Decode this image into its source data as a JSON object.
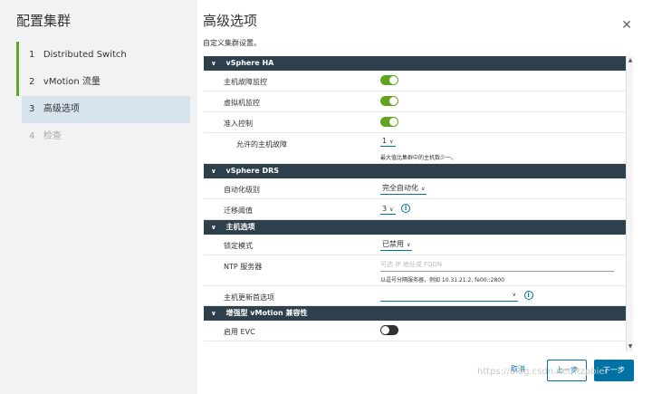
{
  "sidebar": {
    "title": "配置集群",
    "steps": [
      {
        "num": "1",
        "label": "Distributed Switch"
      },
      {
        "num": "2",
        "label": "vMotion 流量"
      },
      {
        "num": "3",
        "label": "高级选项"
      },
      {
        "num": "4",
        "label": "检查"
      }
    ]
  },
  "main": {
    "title": "高级选项",
    "subtitle": "自定义集群设置。",
    "close_icon": "close-icon"
  },
  "sections": {
    "ha": {
      "title": "vSphere HA",
      "host_monitoring": {
        "label": "主机故障监控",
        "state": "on"
      },
      "vm_monitoring": {
        "label": "虚拟机监控",
        "state": "on"
      },
      "admission_control": {
        "label": "准入控制",
        "state": "on"
      },
      "host_failures": {
        "label": "允许的主机故障",
        "value": "1",
        "hint": "最大值比集群中的主机数少一。"
      }
    },
    "drs": {
      "title": "vSphere DRS",
      "automation": {
        "label": "自动化级别",
        "value": "完全自动化"
      },
      "migration": {
        "label": "迁移阈值",
        "value": "3"
      }
    },
    "host": {
      "title": "主机选项",
      "lockdown": {
        "label": "锁定模式",
        "value": "已禁用"
      },
      "ntp": {
        "label": "NTP 服务器",
        "placeholder": "可选 IP 地址或 FQDN",
        "hint": "以逗号分隔服务器，例如 10.31.21.2, fe00::2800"
      },
      "update": {
        "label": "主机更新首选项",
        "value": ""
      }
    },
    "evc": {
      "title": "增强型 vMotion 兼容性",
      "enable": {
        "label": "启用 EVC",
        "state": "off"
      }
    }
  },
  "footer": {
    "cancel": "取消",
    "back": "上一步",
    "next": "下一步"
  },
  "watermark": "https://blog.csdn.net/itzpbier",
  "colors": {
    "accent": "#0072a3",
    "toggle_on": "#62a420",
    "section_bg": "#2f404d",
    "active_step": "#d7e4ee"
  }
}
